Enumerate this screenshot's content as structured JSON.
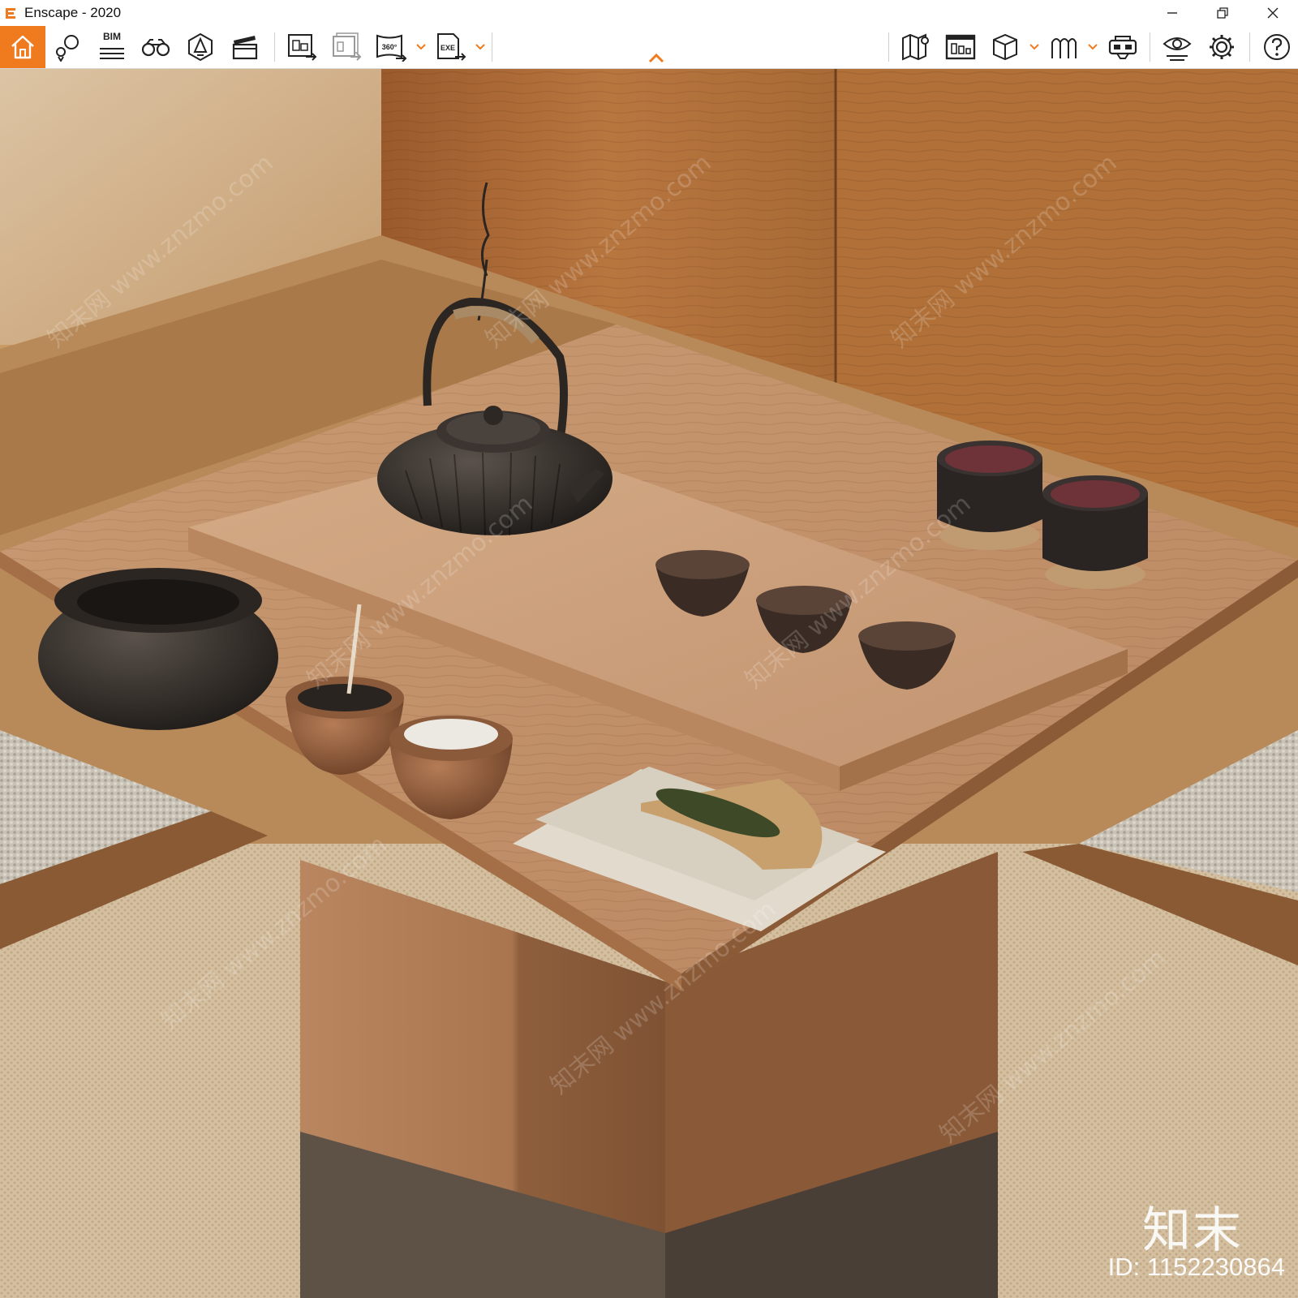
{
  "window": {
    "title": "Enscape - 2020",
    "accent_color": "#f07a1e",
    "controls": [
      "minimize-icon",
      "restore-icon",
      "close-icon"
    ]
  },
  "toolbar": {
    "bim_label": "BIM",
    "left_tools": [
      "home-icon",
      "views-icon",
      "bim-icon",
      "binoculars-icon",
      "atmosphere-icon",
      "video-editor-icon",
      "render-image-icon",
      "batch-render-icon",
      "panorama-360-icon",
      "export-exe-icon"
    ],
    "panorama_label": "360°",
    "exe_label": "EXE",
    "right_tools": [
      "map-icon",
      "material-editor-icon",
      "asset-library-icon",
      "upload-icon",
      "vr-headset-icon",
      "visual-settings-icon",
      "settings-icon",
      "help-icon"
    ]
  },
  "watermark": {
    "logo_text": "知末",
    "id_text": "ID: 1152230864",
    "diagonal_text": "知末网 www.znzmo.com"
  }
}
